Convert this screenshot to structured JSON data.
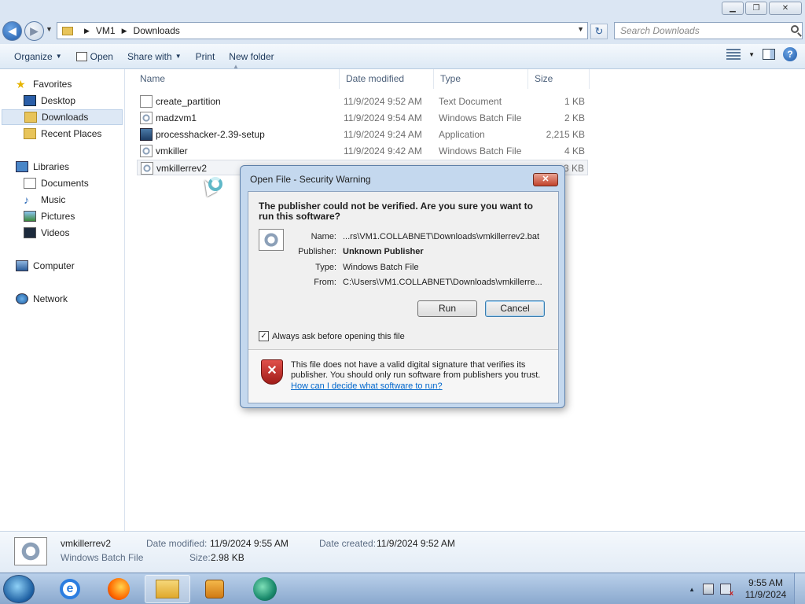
{
  "window": {
    "minimize_glyph": "▁",
    "maximize_glyph": "❐",
    "close_glyph": "✕"
  },
  "address": {
    "crumbs": [
      "VM1",
      "Downloads"
    ],
    "search_placeholder": "Search Downloads"
  },
  "toolbar": {
    "organize": "Organize",
    "open": "Open",
    "share_with": "Share with",
    "print": "Print",
    "new_folder": "New folder"
  },
  "nav": {
    "favorites": "Favorites",
    "desktop": "Desktop",
    "downloads": "Downloads",
    "recent_places": "Recent Places",
    "libraries": "Libraries",
    "documents": "Documents",
    "music": "Music",
    "pictures": "Pictures",
    "videos": "Videos",
    "computer": "Computer",
    "network": "Network"
  },
  "columns": {
    "name": "Name",
    "date_modified": "Date modified",
    "type": "Type",
    "size": "Size"
  },
  "files": [
    {
      "name": "create_partition",
      "date": "11/9/2024 9:52 AM",
      "type": "Text Document",
      "size": "1 KB",
      "icon": "text-file-icon"
    },
    {
      "name": "madzvm1",
      "date": "11/9/2024 9:54 AM",
      "type": "Windows Batch File",
      "size": "2 KB",
      "icon": "batch-file-icon"
    },
    {
      "name": "processhacker-2.39-setup",
      "date": "11/9/2024 9:24 AM",
      "type": "Application",
      "size": "2,215 KB",
      "icon": "application-icon"
    },
    {
      "name": "vmkiller",
      "date": "11/9/2024 9:42 AM",
      "type": "Windows Batch File",
      "size": "4 KB",
      "icon": "batch-file-icon"
    },
    {
      "name": "vmkillerrev2",
      "date": "",
      "type": "",
      "size": "3 KB",
      "icon": "batch-file-icon"
    }
  ],
  "dialog": {
    "title": "Open File - Security Warning",
    "question": "The publisher could not be verified.  Are you sure you want to run this software?",
    "name_label": "Name:",
    "name_value": "...rs\\VM1.COLLABNET\\Downloads\\vmkillerrev2.bat",
    "publisher_label": "Publisher:",
    "publisher_value": "Unknown Publisher",
    "type_label": "Type:",
    "type_value": "Windows Batch File",
    "from_label": "From:",
    "from_value": "C:\\Users\\VM1.COLLABNET\\Downloads\\vmkillerre...",
    "run_button": "Run",
    "cancel_button": "Cancel",
    "checkbox_label": "Always ask before opening this file",
    "checkbox_checked": true,
    "warning_text": "This file does not have a valid digital signature that verifies its publisher.  You should only run software from publishers you trust.",
    "help_link": "How can I decide what software to run?"
  },
  "details": {
    "name": "vmkillerrev2",
    "type": "Windows Batch File",
    "date_modified_label": "Date modified:",
    "date_modified": "11/9/2024 9:55 AM",
    "size_label": "Size:",
    "size": "2.98 KB",
    "date_created_label": "Date created:",
    "date_created": "11/9/2024 9:52 AM"
  },
  "taskbar": {
    "apps": [
      "internet-explorer-icon",
      "firefox-icon",
      "file-explorer-icon",
      "media-player-icon",
      "browser-globe-icon"
    ],
    "active_app": "file-explorer-icon",
    "time": "9:55 AM",
    "date": "11/9/2024"
  }
}
